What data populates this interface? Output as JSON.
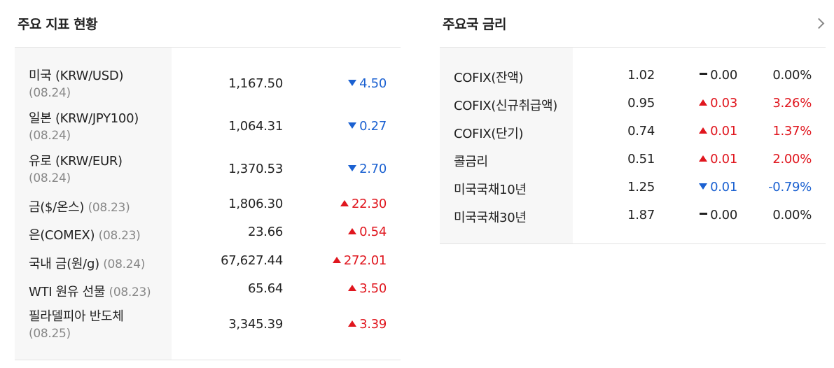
{
  "left": {
    "title": "주요 지표 현황",
    "rows": [
      {
        "name": "미국 (KRW/USD)",
        "date": "(08.24)",
        "value": "1,167.50",
        "change": "4.50",
        "dir": "down"
      },
      {
        "name": "일본 (KRW/JPY100)",
        "date": "(08.24)",
        "value": "1,064.31",
        "change": "0.27",
        "dir": "down"
      },
      {
        "name": "유로 (KRW/EUR)",
        "date": "(08.24)",
        "value": "1,370.53",
        "change": "2.70",
        "dir": "down"
      },
      {
        "name": "금($/온스)",
        "date": "(08.23)",
        "value": "1,806.30",
        "change": "22.30",
        "dir": "up"
      },
      {
        "name": "은(COMEX)",
        "date": "(08.23)",
        "value": "23.66",
        "change": "0.54",
        "dir": "up"
      },
      {
        "name": "국내 금(원/g)",
        "date": "(08.24)",
        "value": "67,627.44",
        "change": "272.01",
        "dir": "up"
      },
      {
        "name": "WTI 원유 선물",
        "date": "(08.23)",
        "value": "65.64",
        "change": "3.50",
        "dir": "up"
      },
      {
        "name": "필라델피아 반도체",
        "date": "(08.25)",
        "value": "3,345.39",
        "change": "3.39",
        "dir": "up"
      }
    ]
  },
  "right": {
    "title": "주요국 금리",
    "rows": [
      {
        "name": "COFIX(잔액)",
        "value": "1.02",
        "change": "0.00",
        "pct": "0.00%",
        "dir": "flat"
      },
      {
        "name": "COFIX(신규취급액)",
        "value": "0.95",
        "change": "0.03",
        "pct": "3.26%",
        "dir": "up"
      },
      {
        "name": "COFIX(단기)",
        "value": "0.74",
        "change": "0.01",
        "pct": "1.37%",
        "dir": "up"
      },
      {
        "name": "콜금리",
        "value": "0.51",
        "change": "0.01",
        "pct": "2.00%",
        "dir": "up"
      },
      {
        "name": "미국국채10년",
        "value": "1.25",
        "change": "0.01",
        "pct": "-0.79%",
        "dir": "down"
      },
      {
        "name": "미국국채30년",
        "value": "1.87",
        "change": "0.00",
        "pct": "0.00%",
        "dir": "flat"
      }
    ]
  },
  "icons": {
    "more": "chevron-right-icon",
    "up": "triangle-up-icon",
    "down": "triangle-down-icon",
    "flat": "dash-icon"
  },
  "colors": {
    "up": "#e0161e",
    "down": "#1b61d1",
    "flat": "#222222",
    "name_bg": "#f7f7f7"
  }
}
